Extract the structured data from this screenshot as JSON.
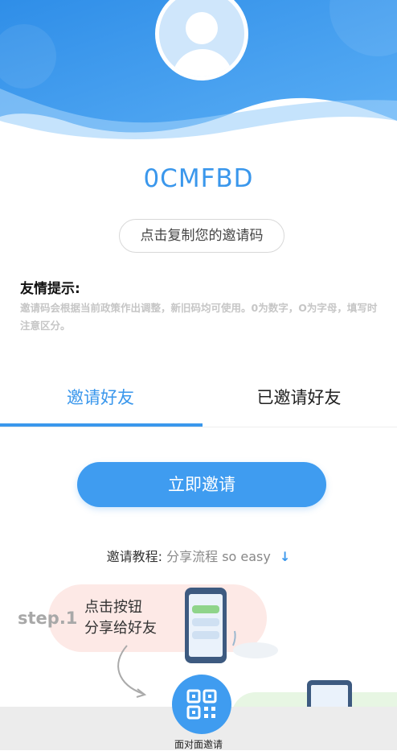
{
  "profile": {
    "invite_code": "0CMFBD",
    "copy_button": "点击复制您的邀请码"
  },
  "tips": {
    "title": "友情提示:",
    "text": "邀请码会根据当前政策作出调整，新旧码均可使用。0为数字，O为字母，填写时注意区分。"
  },
  "tabs": [
    {
      "label": "邀请好友",
      "active": true
    },
    {
      "label": "已邀请好友",
      "active": false
    }
  ],
  "invite_button": "立即邀请",
  "tutorial": {
    "label": "邀请教程:",
    "sub": "分享流程 so easy",
    "arrow": "↓"
  },
  "step1": {
    "label": "step.1",
    "line1": "点击按钮",
    "line2": "分享给好友"
  },
  "bottom": {
    "qr_label": "面对面邀请"
  },
  "colors": {
    "accent": "#3a97ec",
    "header_blue": "#3f9cf0"
  },
  "icons": {
    "avatar": "user-avatar-icon",
    "qr": "qr-code-icon",
    "arrow": "arrow-down-icon"
  }
}
